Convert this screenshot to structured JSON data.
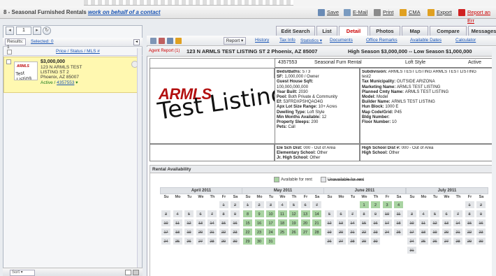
{
  "window": {
    "title_prefix": "8 - Seasonal Furnished Rentals",
    "title_link": "work on behalf of a contact",
    "toolbar": [
      {
        "label": "Save",
        "icon": "save-icon",
        "color": "#6a8bb5"
      },
      {
        "label": "E-Mail",
        "icon": "email-icon",
        "color": "#7a9bc0"
      },
      {
        "label": "Print",
        "icon": "print-icon",
        "color": "#8a8a8a"
      },
      {
        "label": "CMA",
        "icon": "cma-icon",
        "color": "#e0a020"
      },
      {
        "label": "Export",
        "icon": "export-icon",
        "color": "#e0a020"
      },
      {
        "label": "Report an Err",
        "icon": "warning-icon",
        "color": "#d02020"
      }
    ]
  },
  "left": {
    "page_value": "1",
    "results_label": "Results: 1",
    "selected_label": "Selected: 0",
    "sort_links": "Price / Status / MLS #",
    "listing": {
      "price": "$3,000,000",
      "address1": "123 N ARMLS TEST",
      "address2": "LISTING ST 2",
      "city": "Phoenix, AZ 85007",
      "status": "Active / ",
      "mls": "4357553",
      "thumb_logo": "ARMLS",
      "thumb_text": "Test Listing"
    },
    "sort_by": "Sort ▾"
  },
  "tabs": [
    "Edit Search",
    "List",
    "Detail",
    "Photos",
    "Map",
    "Compare",
    "Messages"
  ],
  "active_tab": "Detail",
  "right_toolbar": {
    "report_btn": "Report ▾",
    "links": [
      "History",
      "Tax Info",
      "Statistics ▾",
      "Documents",
      "Office Remarks",
      "Available Dates",
      "Calculator"
    ]
  },
  "header": {
    "agent": "Agent Report (1)",
    "address": "123 N ARMLS TEST LISTING ST 2 Phoenix, AZ 85007",
    "price": "High Season $3,000,000 -- Low Season $1,000,000"
  },
  "report": {
    "mls": "4357553",
    "type": "Seasonal Furn Rental",
    "style": "Loft Style",
    "status": "Active",
    "logo": "ARMLS",
    "photo_text": "Test Listing",
    "details_left": [
      [
        "Beds/Baths:",
        "5 / 3"
      ],
      [
        "SF:",
        "1,000,000 / Owner"
      ],
      [
        "Guest House Sqft:",
        ""
      ],
      [
        "",
        "100,000,000,000"
      ],
      [
        "Year Built:",
        "2030"
      ],
      [
        "Pool:",
        "Both Private & Community"
      ],
      [
        "Ef:",
        "53FRDXPSHQAO4G"
      ],
      [
        "Apx Lot Size Range:",
        "10+ Acres"
      ],
      [
        "Dwelling Type:",
        "Loft Style"
      ],
      [
        "Min Months Available:",
        "12"
      ],
      [
        "Property Sleeps:",
        "200"
      ],
      [
        "Pets:",
        "Call"
      ]
    ],
    "details_right": [
      [
        "Subdivision:",
        "ARMLS TEST LISTING ARMLS TEST LISTING"
      ],
      [
        "",
        "test2"
      ],
      [
        "Tax Municipality:",
        "OUTSIDE ARIZONA"
      ],
      [
        "Marketing Name:",
        "ARMLS TEST LISTING"
      ],
      [
        "Planned Cmty Name:",
        "ARMLS TEST LISTING"
      ],
      [
        "Model:",
        "Model"
      ],
      [
        "Builder Name:",
        "ARMLS TEST LISTING"
      ],
      [
        "Hun Block:",
        "1000 E"
      ],
      [
        "Map Code/Grid:",
        "P45"
      ],
      [
        "Bldg Number:",
        ""
      ],
      [
        "Floor Number:",
        "10"
      ]
    ],
    "schools_left": [
      [
        "Ele Sch Dist:",
        "000 - Out of Area"
      ],
      [
        "Elementary School:",
        "Other"
      ],
      [
        "Jr. High School:",
        "Other"
      ]
    ],
    "schools_right": [
      [
        "High School Dist #:",
        "000 - Out of Area"
      ],
      [
        "High School:",
        "Other"
      ]
    ]
  },
  "availability": {
    "title": "Rental Availability",
    "legend_available": "Available for rent",
    "legend_unavailable": "Unavailable for rent",
    "available_color": "#a9d4a2",
    "unavailable_color": "#e4e6e9",
    "dows": [
      "Su",
      "Mo",
      "Tu",
      "We",
      "Th",
      "Fr",
      "Sa"
    ],
    "months": [
      {
        "name": "April 2011",
        "start": 5,
        "days": 30,
        "available": []
      },
      {
        "name": "May 2011",
        "start": 0,
        "days": 31,
        "available": [
          8,
          9,
          10,
          11,
          12,
          13,
          14,
          15,
          16,
          17,
          18,
          19,
          20,
          21,
          22,
          23,
          24,
          25,
          26,
          27,
          28,
          29,
          30,
          31
        ]
      },
      {
        "name": "June 2011",
        "start": 3,
        "days": 30,
        "available": [
          1,
          2,
          3,
          4
        ]
      },
      {
        "name": "July 2011",
        "start": 5,
        "days": 31,
        "available": []
      }
    ]
  }
}
